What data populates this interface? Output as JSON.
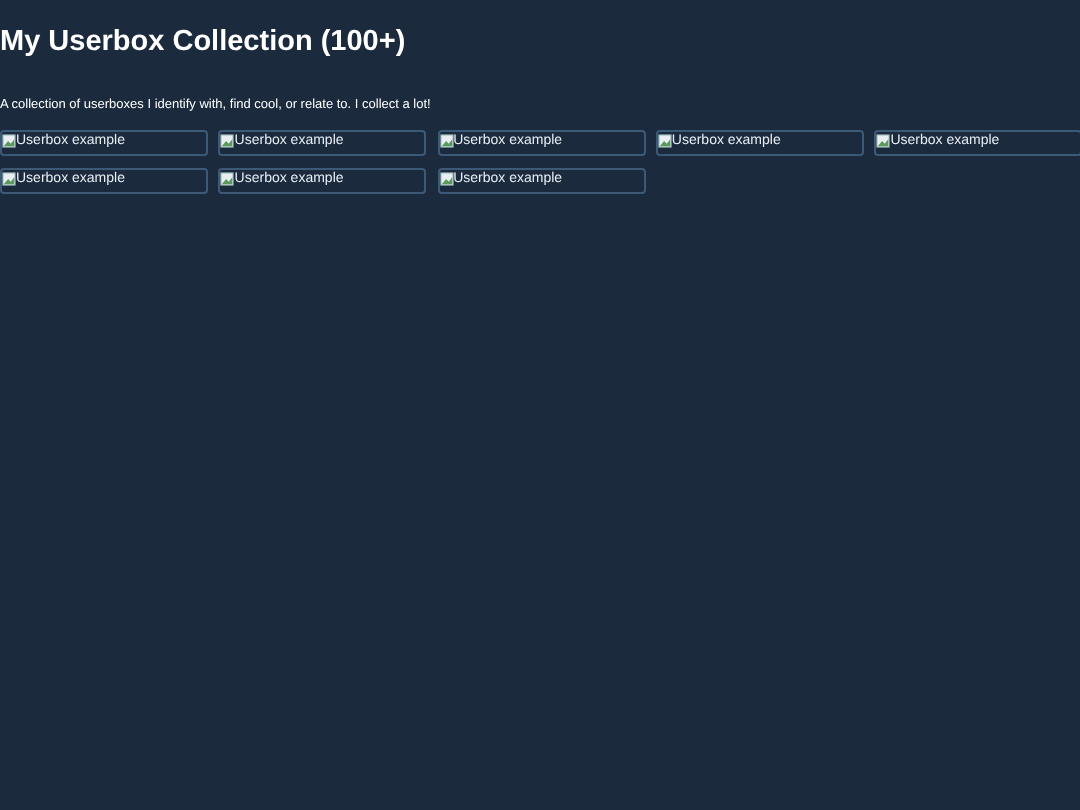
{
  "title": "My Userbox Collection (100+)",
  "description": "A collection of userboxes I identify with, find cool, or relate to. I collect a lot!",
  "userboxes": [
    {
      "alt": "Userbox example"
    },
    {
      "alt": "Userbox example"
    },
    {
      "alt": "Userbox example"
    },
    {
      "alt": "Userbox example"
    },
    {
      "alt": "Userbox example"
    },
    {
      "alt": "Userbox example"
    },
    {
      "alt": "Userbox example"
    },
    {
      "alt": "Userbox example"
    }
  ]
}
